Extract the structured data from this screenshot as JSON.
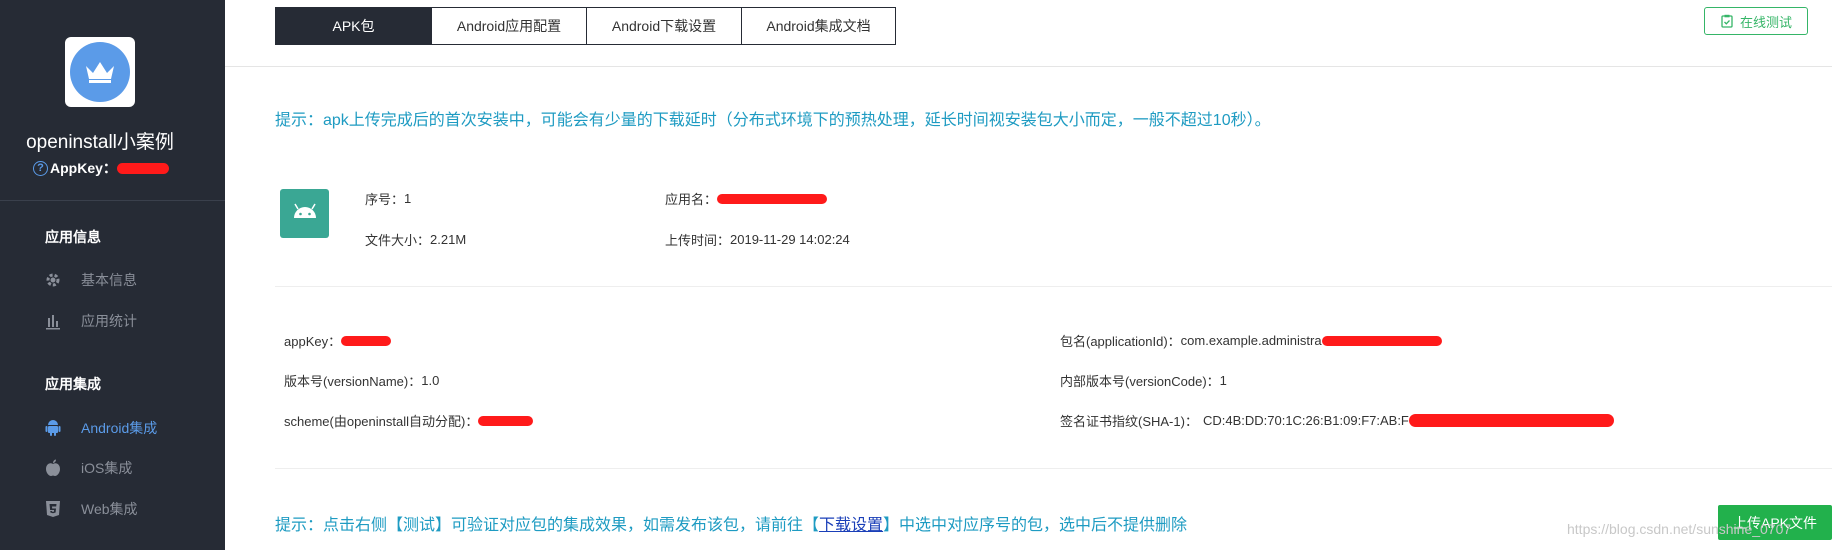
{
  "sidebar": {
    "app_name": "openinstall小案例",
    "appkey_label": "AppKey：",
    "sections": [
      {
        "title": "应用信息",
        "items": [
          {
            "label": "基本信息",
            "icon": "gear-icon"
          },
          {
            "label": "应用统计",
            "icon": "bar-chart-icon"
          }
        ]
      },
      {
        "title": "应用集成",
        "items": [
          {
            "label": "Android集成",
            "icon": "android-icon",
            "active": true
          },
          {
            "label": "iOS集成",
            "icon": "apple-icon"
          },
          {
            "label": "Web集成",
            "icon": "html5-icon"
          }
        ]
      }
    ]
  },
  "tabs": [
    {
      "label": "APK包",
      "active": true
    },
    {
      "label": "Android应用配置"
    },
    {
      "label": "Android下载设置"
    },
    {
      "label": "Android集成文档"
    }
  ],
  "test_button": "在线测试",
  "tip1": "提示：apk上传完成后的首次安装中，可能会有少量的下载延时（分布式环境下的预热处理，延长时间视安装包大小而定，一般不超过10秒）。",
  "apk": {
    "seq_label": "序号：",
    "seq": "1",
    "name_label": "应用名：",
    "size_label": "文件大小：",
    "size": "2.21M",
    "upload_time_label": "上传时间：",
    "upload_time": "2019-11-29 14:02:24"
  },
  "details": {
    "appkey_label": "appKey：",
    "package_label": "包名(applicationId)：",
    "package_value": "com.example.administra",
    "version_name_label": "版本号(versionName)：",
    "version_name": "1.0",
    "version_code_label": "内部版本号(versionCode)：",
    "version_code": "1",
    "scheme_label": "scheme(由openinstall自动分配)：",
    "sha_label": "签名证书指纹(SHA-1)：",
    "sha_value": "CD:4B:DD:70:1C:26:B1:09:F7:AB:F"
  },
  "tip2": {
    "before": "提示：点击右侧【测试】可验证对应包的集成效果，如需发布该包，请前往【",
    "link": "下载设置",
    "after": "】中选中对应序号的包，选中后不提供删除"
  },
  "upload_button": "上传APK文件",
  "watermark": "https://blog.csdn.net/sunshine_0707",
  "colors": {
    "sidebar_bg": "#262b35",
    "accent_blue": "#5b9be8",
    "tip_text": "#1e9bc2",
    "green": "#22b14c",
    "redaction": "#ff1a1a"
  }
}
